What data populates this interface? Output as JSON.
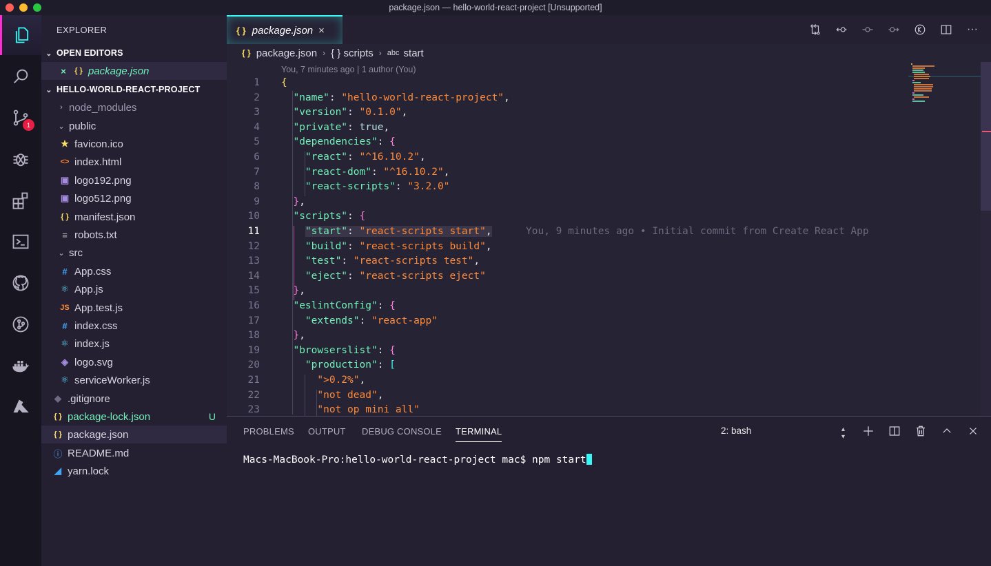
{
  "window": {
    "title": "package.json — hello-world-react-project [Unsupported]"
  },
  "colors": {
    "accent": "#36f9f6",
    "pink": "#ff2dd1",
    "badge": "#e91e44",
    "folder_text": "#d8d5e0"
  },
  "activity": {
    "scm_badge": "1"
  },
  "sidebar": {
    "title": "EXPLORER",
    "open_editors": {
      "label": "OPEN EDITORS",
      "items": [
        {
          "name": "package.json",
          "icon": "{ }"
        }
      ]
    },
    "project": {
      "label": "HELLO-WORLD-REACT-PROJECT",
      "items": [
        {
          "name": "node_modules",
          "icon": "›"
        },
        {
          "name": "public",
          "icon": "⌄"
        },
        {
          "name": "favicon.ico",
          "icon": "★"
        },
        {
          "name": "index.html",
          "icon": "<>"
        },
        {
          "name": "logo192.png",
          "icon": "▣"
        },
        {
          "name": "logo512.png",
          "icon": "▣"
        },
        {
          "name": "manifest.json",
          "icon": "{ }"
        },
        {
          "name": "robots.txt",
          "icon": "≡"
        },
        {
          "name": "src",
          "icon": "⌄"
        },
        {
          "name": "App.css",
          "icon": "#"
        },
        {
          "name": "App.js",
          "icon": "⚛"
        },
        {
          "name": "App.test.js",
          "icon": "JS"
        },
        {
          "name": "index.css",
          "icon": "#"
        },
        {
          "name": "index.js",
          "icon": "⚛"
        },
        {
          "name": "logo.svg",
          "icon": "◈"
        },
        {
          "name": "serviceWorker.js",
          "icon": "⚛"
        },
        {
          "name": ".gitignore",
          "icon": "◆"
        },
        {
          "name": "package-lock.json",
          "icon": "{ }",
          "status": "U"
        },
        {
          "name": "package.json",
          "icon": "{ }"
        },
        {
          "name": "README.md",
          "icon": "ⓘ"
        },
        {
          "name": "yarn.lock",
          "icon": "◢"
        }
      ]
    }
  },
  "editor": {
    "tab": {
      "label": "package.json",
      "icon": "{ }"
    },
    "breadcrumb": {
      "file": "package.json",
      "obj": "{ } scripts",
      "key_icon": "abc",
      "key": "start"
    },
    "blame_header": "You, 7 minutes ago | 1 author (You)",
    "inline_blame": "You, 9 minutes ago • Initial commit from Create React App",
    "current_line": 11,
    "lines": [
      {
        "n": "1",
        "t": "{"
      },
      {
        "n": "2",
        "t": "  \"name\": \"hello-world-react-project\","
      },
      {
        "n": "3",
        "t": "  \"version\": \"0.1.0\","
      },
      {
        "n": "4",
        "t": "  \"private\": true,"
      },
      {
        "n": "5",
        "t": "  \"dependencies\": {"
      },
      {
        "n": "6",
        "t": "    \"react\": \"^16.10.2\","
      },
      {
        "n": "7",
        "t": "    \"react-dom\": \"^16.10.2\","
      },
      {
        "n": "8",
        "t": "    \"react-scripts\": \"3.2.0\""
      },
      {
        "n": "9",
        "t": "  },"
      },
      {
        "n": "10",
        "t": "  \"scripts\": {"
      },
      {
        "n": "11",
        "t": "    \"start\": \"react-scripts start\","
      },
      {
        "n": "12",
        "t": "    \"build\": \"react-scripts build\","
      },
      {
        "n": "13",
        "t": "    \"test\": \"react-scripts test\","
      },
      {
        "n": "14",
        "t": "    \"eject\": \"react-scripts eject\""
      },
      {
        "n": "15",
        "t": "  },"
      },
      {
        "n": "16",
        "t": "  \"eslintConfig\": {"
      },
      {
        "n": "17",
        "t": "    \"extends\": \"react-app\""
      },
      {
        "n": "18",
        "t": "  },"
      },
      {
        "n": "19",
        "t": "  \"browserslist\": {"
      },
      {
        "n": "20",
        "t": "    \"production\": ["
      },
      {
        "n": "21",
        "t": "      \">0.2%\","
      },
      {
        "n": "22",
        "t": "      \"not dead\","
      },
      {
        "n": "23",
        "t": "      \"not op mini all\""
      }
    ]
  },
  "panel": {
    "tabs": [
      "PROBLEMS",
      "OUTPUT",
      "DEBUG CONSOLE",
      "TERMINAL"
    ],
    "active_tab": "TERMINAL",
    "shell": "2: bash",
    "prompt": "Macs-MacBook-Pro:hello-world-react-project mac$ npm start"
  }
}
